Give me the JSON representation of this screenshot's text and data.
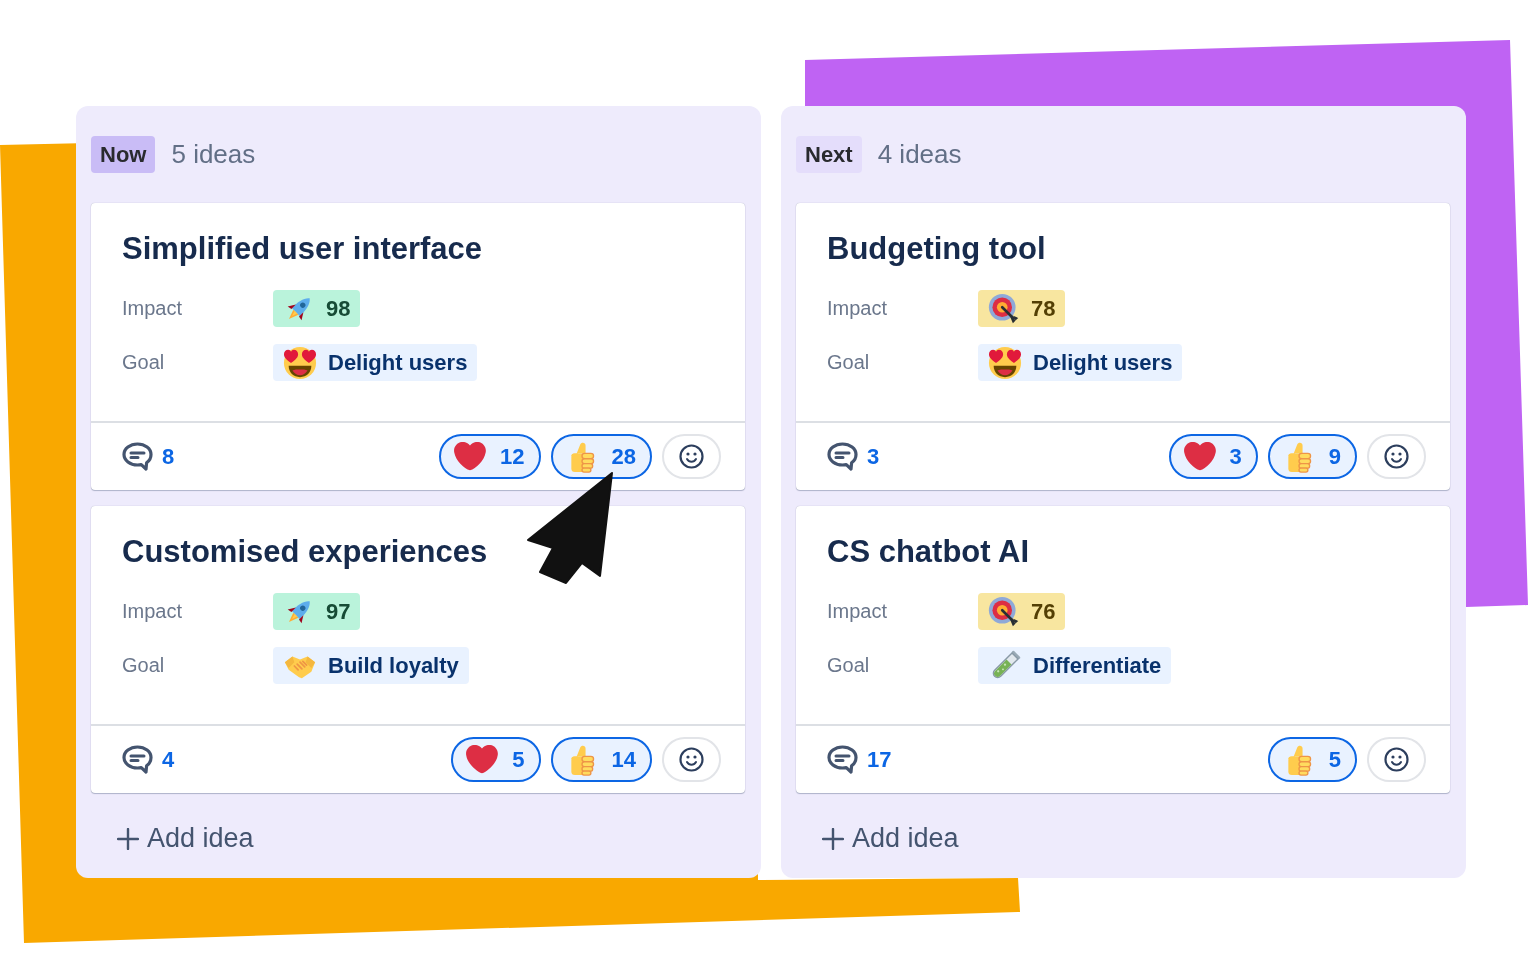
{
  "columns": [
    {
      "label": "Now",
      "color": "#c9bcf6",
      "count": "5 ideas",
      "ideas": [
        {
          "title": "Simplified user interface",
          "impact": {
            "label": "Impact",
            "kind": "high",
            "value": "98"
          },
          "goal": {
            "label": "Goal",
            "kind": "delight",
            "value": "Delight users"
          },
          "comments": "8",
          "reactions": [
            {
              "kind": "heart",
              "count": "12",
              "selected": true
            },
            {
              "kind": "thumbs",
              "count": "28",
              "selected": true
            }
          ]
        },
        {
          "title": "Customised experiences",
          "impact": {
            "label": "Impact",
            "kind": "high",
            "value": "97"
          },
          "goal": {
            "label": "Goal",
            "kind": "loyalty",
            "value": "Build loyalty"
          },
          "comments": "4",
          "reactions": [
            {
              "kind": "heart",
              "count": "5",
              "selected": true
            },
            {
              "kind": "thumbs",
              "count": "14",
              "selected": true
            }
          ]
        }
      ],
      "add_label": "Add idea"
    },
    {
      "label": "Next",
      "color": "#e4ddfb",
      "count": "4 ideas",
      "ideas": [
        {
          "title": "Budgeting tool",
          "impact": {
            "label": "Impact",
            "kind": "medium",
            "value": "78"
          },
          "goal": {
            "label": "Goal",
            "kind": "delight",
            "value": "Delight users"
          },
          "comments": "3",
          "reactions": [
            {
              "kind": "heart",
              "count": "3",
              "selected": true
            },
            {
              "kind": "thumbs",
              "count": "9",
              "selected": true
            }
          ]
        },
        {
          "title": "CS chatbot AI",
          "impact": {
            "label": "Impact",
            "kind": "medium",
            "value": "76"
          },
          "goal": {
            "label": "Goal",
            "kind": "differentiate",
            "value": "Differentiate"
          },
          "comments": "17",
          "reactions": [
            {
              "kind": "thumbs",
              "count": "5",
              "selected": true
            }
          ]
        }
      ],
      "add_label": "Add idea"
    }
  ]
}
